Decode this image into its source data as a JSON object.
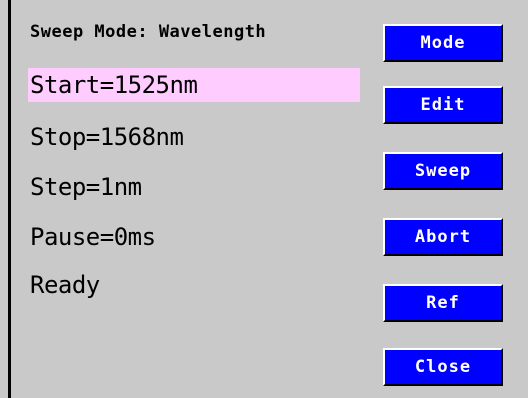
{
  "header": {
    "sweep_mode_label": "Sweep Mode: Wavelength"
  },
  "params": {
    "start": "Start=1525nm",
    "stop": "Stop=1568nm",
    "step": "Step=1nm",
    "pause": "Pause=0ms",
    "status": "Ready"
  },
  "buttons": {
    "mode": "Mode",
    "edit": "Edit",
    "sweep": "Sweep",
    "abort": "Abort",
    "ref": "Ref",
    "close": "Close"
  },
  "colors": {
    "background": "#c9c9c9",
    "selected_row": "#ffccff",
    "button_bg": "#0000ff",
    "button_text": "#ffffff"
  }
}
